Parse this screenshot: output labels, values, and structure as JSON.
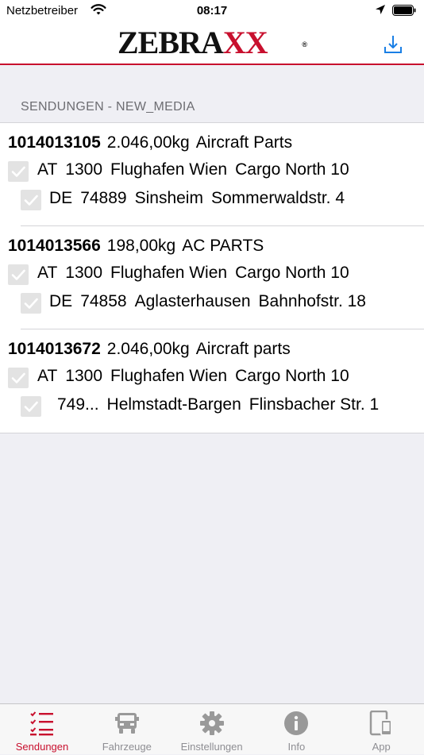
{
  "status_bar": {
    "carrier": "Netzbetreiber",
    "time": "08:17"
  },
  "nav": {
    "logo_text": "ZEBRA",
    "logo_x": "XX",
    "logo_reg": "®"
  },
  "section_title": "SENDUNGEN - NEW_MEDIA",
  "shipments": [
    {
      "id": "1014013105",
      "weight": "2.046,00kg",
      "description": "Aircraft Parts",
      "from": {
        "country": "AT",
        "zip": "1300",
        "city": "Flughafen Wien",
        "street": "Cargo North 10",
        "checked": true
      },
      "to": {
        "country": "DE",
        "zip": "74889",
        "city": "Sinsheim",
        "street": "Sommerwaldstr. 4",
        "checked": true
      }
    },
    {
      "id": "1014013566",
      "weight": "198,00kg",
      "description": "AC PARTS",
      "from": {
        "country": "AT",
        "zip": "1300",
        "city": "Flughafen Wien",
        "street": "Cargo North 10",
        "checked": true
      },
      "to": {
        "country": "DE",
        "zip": "74858",
        "city": "Aglasterhausen",
        "street": "Bahnhofstr. 18",
        "checked": true
      }
    },
    {
      "id": "1014013672",
      "weight": "2.046,00kg",
      "description": "Aircraft parts",
      "from": {
        "country": "AT",
        "zip": "1300",
        "city": "Flughafen Wien",
        "street": "Cargo North 10",
        "checked": true
      },
      "to": {
        "country": "",
        "zip": "749...",
        "city": "Helmstadt-Bargen",
        "street": "Flinsbacher Str. 1",
        "checked": true
      }
    }
  ],
  "tabs": [
    {
      "label": "Sendungen",
      "icon": "checklist-icon",
      "active": true
    },
    {
      "label": "Fahrzeuge",
      "icon": "truck-icon",
      "active": false
    },
    {
      "label": "Einstellungen",
      "icon": "gear-icon",
      "active": false
    },
    {
      "label": "Info",
      "icon": "info-icon",
      "active": false
    },
    {
      "label": "App",
      "icon": "devices-icon",
      "active": false
    }
  ],
  "colors": {
    "accent": "#c8102e",
    "link": "#1a7fe5",
    "background": "#efeff4",
    "checkbox": "#e3e3e3",
    "tab_inactive": "#8e8e93"
  }
}
